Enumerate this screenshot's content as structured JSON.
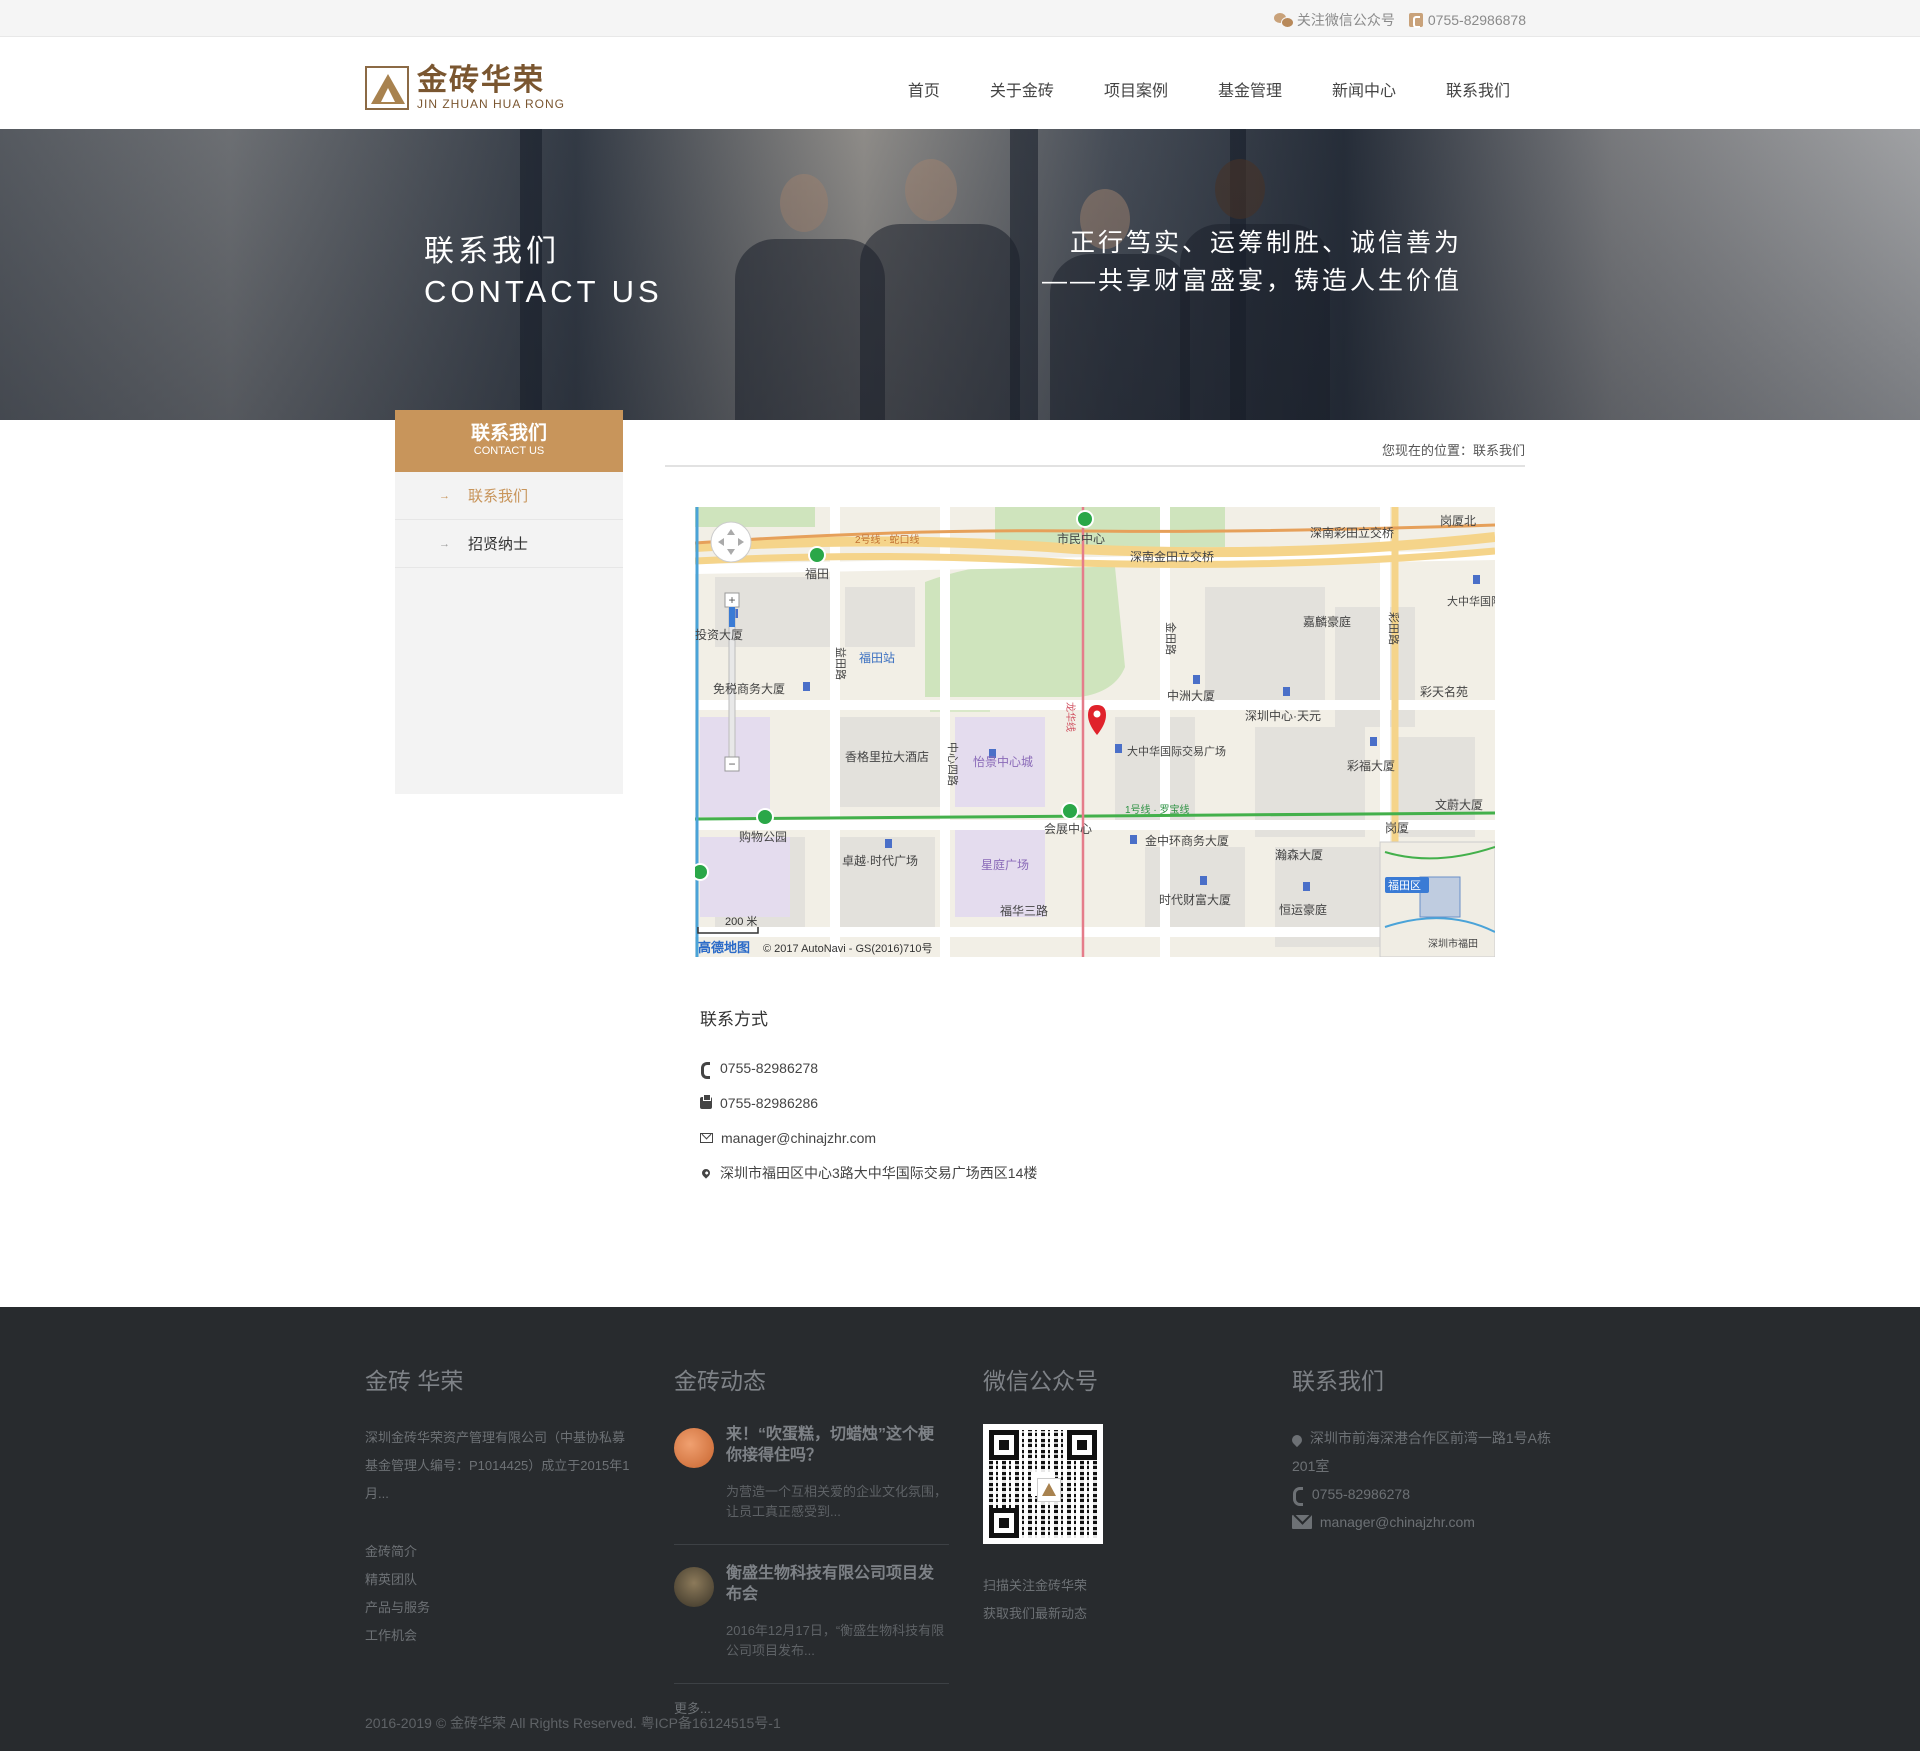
{
  "topbar": {
    "wechat_label": "关注微信公众号",
    "phone": "0755-82986878"
  },
  "logo": {
    "cn": "金砖华荣",
    "en": "JIN ZHUAN HUA RONG"
  },
  "nav": [
    "首页",
    "关于金砖",
    "项目案例",
    "基金管理",
    "新闻中心",
    "联系我们"
  ],
  "banner": {
    "title_cn": "联系我们",
    "title_en": "CONTACT US",
    "slogan_line1": "正行笃实、运筹制胜、诚信善为",
    "slogan_line2": "——共享财富盛宴，铸造人生价值"
  },
  "sidebar": {
    "title_cn": "联系我们",
    "title_en": "CONTACT US",
    "items": [
      {
        "label": "联系我们",
        "active": true
      },
      {
        "label": "招贤纳士",
        "active": false
      }
    ]
  },
  "breadcrumb": "您现在的位置：联系我们",
  "map": {
    "scale": "200 米",
    "provider": "高德地图",
    "copyright": "© 2017 AutoNavi - GS(2016)710号",
    "labels": [
      "福田",
      "市民中心",
      "深南金田立交桥",
      "深南彩田立交桥",
      "岗厦北",
      "投资大厦",
      "福田站",
      "嘉麟豪庭",
      "大中华国际金融中心",
      "免税商务大厦",
      "中洲大厦",
      "深圳中心·天元",
      "彩天名苑",
      "香格里拉大酒店",
      "怡景中心城",
      "大中华国际交易广场",
      "彩福大厦",
      "购物公园",
      "会展中心",
      "金中环商务大厦",
      "瀚森大厦",
      "文蔚大厦",
      "岗厦",
      "卓越·时代广场",
      "星庭广场",
      "福华三路",
      "时代财富大厦",
      "恒运豪庭",
      "福田区",
      "益田路",
      "金田路",
      "彩田路",
      "中心四路",
      "龙华线",
      "1号线 · 罗宝线",
      "2号线 · 蛇口线",
      "深圳市福田"
    ]
  },
  "contact": {
    "heading": "联系方式",
    "phone": "0755-82986278",
    "fax": "0755-82986286",
    "email": "manager@chinajzhr.com",
    "address": "深圳市福田区中心3路大中华国际交易广场西区14楼"
  },
  "footer": {
    "about": {
      "heading": "金砖 华荣",
      "text": "深圳金砖华荣资产管理有限公司（中基协私募基金管理人编号：P1014425）成立于2015年1月...",
      "links": [
        "金砖简介",
        "精英团队",
        "产品与服务",
        "工作机会"
      ]
    },
    "news": {
      "heading": "金砖动态",
      "items": [
        {
          "title": "来！“吹蛋糕，切蜡烛”这个梗你接得住吗？",
          "desc": "为营造一个互相关爱的企业文化氛围，让员工真正感受到..."
        },
        {
          "title": "衡盛生物科技有限公司项目发布会",
          "desc": "2016年12月17日，“衡盛生物科技有限公司项目发布..."
        }
      ],
      "more": "更多..."
    },
    "wechat": {
      "heading": "微信公众号",
      "line1": "扫描关注金砖华荣",
      "line2": "获取我们最新动态"
    },
    "contact": {
      "heading": "联系我们",
      "address": "深圳市前海深港合作区前湾一路1号A栋201室",
      "phone": "0755-82986278",
      "email": "manager@chinajzhr.com"
    },
    "copyright": "2016-2019 © 金砖华荣 All Rights Reserved. 粤ICP备16124515号-1"
  },
  "colors": {
    "accent": "#c8955b",
    "brand_dark": "#7a5630",
    "footer_bg": "#282b2e"
  }
}
